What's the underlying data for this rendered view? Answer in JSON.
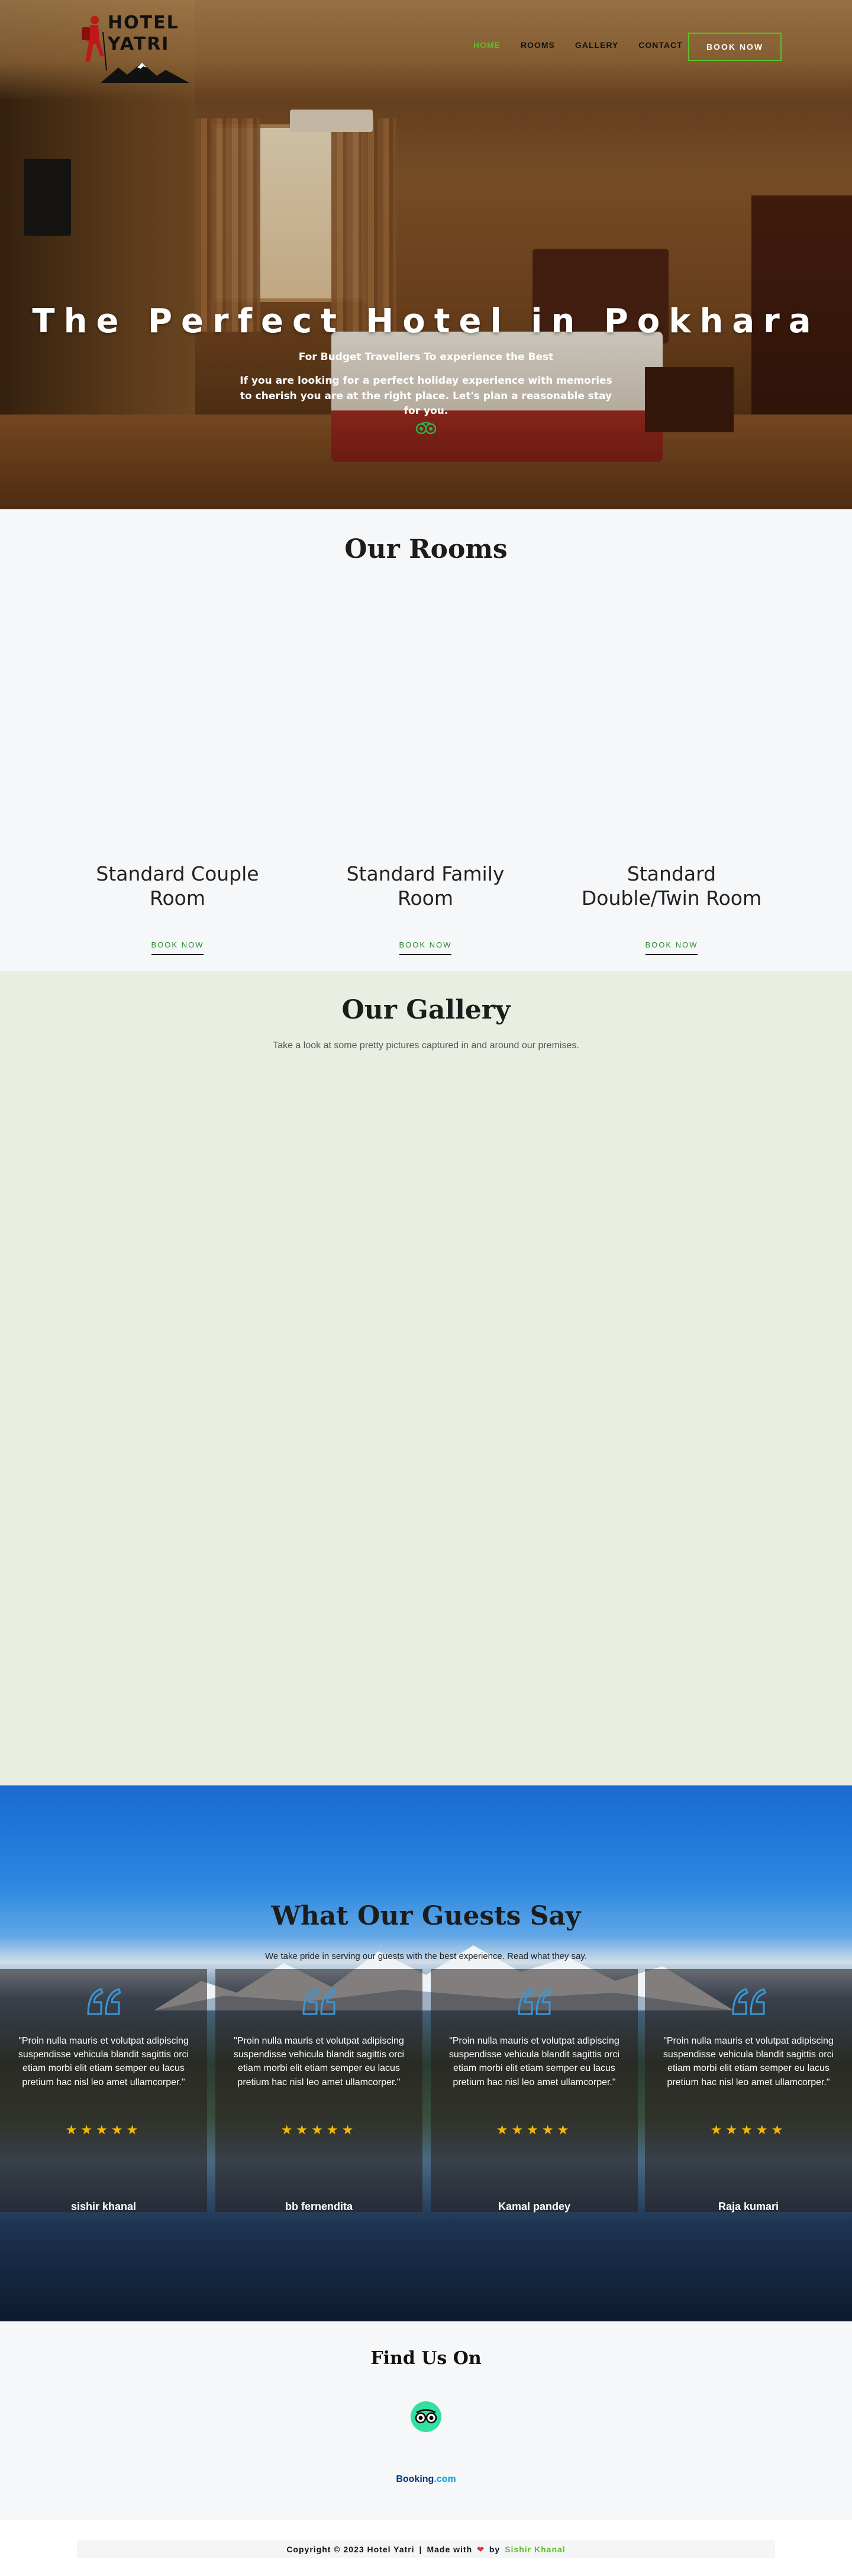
{
  "nav": {
    "logo": {
      "line1": "HOTEL",
      "line2": "YATRI"
    },
    "menu": [
      "HOME",
      "ROOMS",
      "GALLERY",
      "CONTACT"
    ],
    "active_item": "HOME",
    "cta": "BOOK NOW"
  },
  "hero": {
    "title": "The Perfect Hotel in Pokhara",
    "subtitle": "For Budget Travellers To experience the Best",
    "description": "If you are looking for a perfect holiday experience with memories to cherish you are at the right place. Let's plan a reasonable stay for you.",
    "icon": "tripadvisor-owl-icon"
  },
  "rooms": {
    "title": "Our Rooms",
    "items": [
      {
        "name": "Standard Couple Room",
        "link": "BOOK NOW"
      },
      {
        "name": "Standard Family Room",
        "link": "BOOK NOW"
      },
      {
        "name": "Standard Double/Twin Room",
        "link": "BOOK NOW"
      }
    ]
  },
  "gallery": {
    "title": "Our Gallery",
    "subtitle": "Take a look at some pretty pictures captured in and around our premises."
  },
  "testimonials": {
    "title": "What Our Guests Say",
    "subtitle": "We take pride in serving our guests with the best experience. Read what they say.",
    "items": [
      {
        "text": "\"Proin nulla mauris et volutpat adipiscing suspendisse vehicula blandit sagittis orci etiam morbi elit etiam semper eu lacus pretium hac nisl leo amet ullamcorper.\"",
        "stars": "★★★★★",
        "name": "sishir khanal"
      },
      {
        "text": "\"Proin nulla mauris et volutpat adipiscing suspendisse vehicula blandit sagittis orci etiam morbi elit etiam semper eu lacus pretium hac nisl leo amet ullamcorper.\"",
        "stars": "★★★★★",
        "name": "bb fernendita"
      },
      {
        "text": "\"Proin nulla mauris et volutpat adipiscing suspendisse vehicula blandit sagittis orci etiam morbi elit etiam semper eu lacus pretium hac nisl leo amet ullamcorper.\"",
        "stars": "★★★★★",
        "name": "Kamal pandey"
      },
      {
        "text": "\"Proin nulla mauris et volutpat adipiscing suspendisse vehicula blandit sagittis orci etiam morbi elit etiam semper eu lacus pretium hac nisl leo amet ullamcorper.\"",
        "stars": "★★★★★",
        "name": "Raja kumari"
      }
    ],
    "rating": 5
  },
  "find_us": {
    "title": "Find Us On",
    "tripadvisor_icon": "tripadvisor-owl-icon",
    "booking_main": "Booking",
    "booking_suffix": ".com"
  },
  "footer": {
    "copyright": "Copyright © 2023 Hotel Yatri",
    "separator": "|",
    "made_with": "Made with",
    "heart": "❤",
    "by": "by",
    "author": "Sishir Khanal"
  },
  "colors": {
    "accent": "#5cbf2a",
    "star": "#f5b800",
    "dark_text": "#1c1c1c",
    "gallery_bg": "#e8efe2"
  }
}
